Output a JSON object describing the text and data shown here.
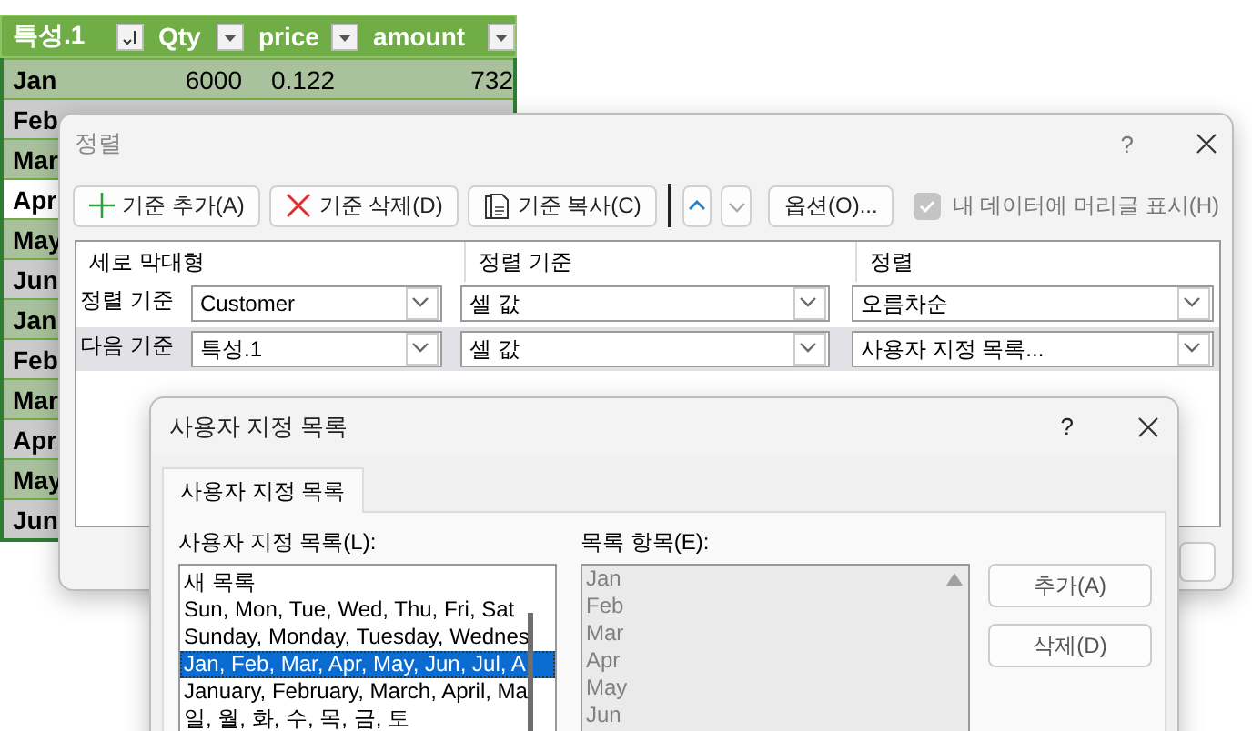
{
  "spreadsheet": {
    "columns": [
      {
        "label": "특성.1"
      },
      {
        "label": "Qty"
      },
      {
        "label": "price"
      },
      {
        "label": "amount"
      }
    ],
    "rows": [
      {
        "month": "Jan",
        "qty": "6000",
        "price": "0.122",
        "amount": "732",
        "selected": false
      },
      {
        "month": "Feb",
        "selected": false
      },
      {
        "month": "Mar",
        "selected": false
      },
      {
        "month": "Apr",
        "selected": true
      },
      {
        "month": "May",
        "selected": false
      },
      {
        "month": "Jun",
        "selected": false
      },
      {
        "month": "Jan",
        "selected": false
      },
      {
        "month": "Feb",
        "selected": false
      },
      {
        "month": "Mar",
        "selected": false
      },
      {
        "month": "Apr",
        "selected": false
      },
      {
        "month": "May",
        "selected": false
      },
      {
        "month": "Jun",
        "selected": false
      }
    ]
  },
  "sort_dialog": {
    "title": "정렬",
    "help": "?",
    "toolbar": [
      {
        "label": "기준 추가(A)"
      },
      {
        "label": "기준 삭제(D)"
      },
      {
        "label": "기준 복사(C)"
      }
    ],
    "move_buttons": [
      {
        "disabled": false
      },
      {
        "disabled": true
      }
    ],
    "options_button": "옵션(O)...",
    "header_checkbox": {
      "label": "내 데이터에 머리글 표시(H)",
      "checked": true,
      "disabled": true
    },
    "columns": [
      "세로 막대형",
      "정렬 기준",
      "정렬"
    ],
    "levels": [
      {
        "label": "정렬 기준",
        "column": "Customer",
        "sort_on": "셀 값",
        "order": "오름차순",
        "selected": false
      },
      {
        "label": "다음 기준",
        "column": "특성.1",
        "sort_on": "셀 값",
        "order": "사용자 지정 목록...",
        "selected": true
      }
    ]
  },
  "list_dialog": {
    "title": "사용자 지정 목록",
    "help": "?",
    "tab": {
      "label": "사용자 지정 목록",
      "selected": true
    },
    "lists_label": "사용자 지정 목록(L):",
    "lists": [
      {
        "text": "새 목록",
        "selected": false
      },
      {
        "text": "Sun, Mon, Tue, Wed, Thu, Fri, Sat",
        "selected": false
      },
      {
        "text": "Sunday, Monday, Tuesday, Wednes",
        "selected": false
      },
      {
        "text": "Jan, Feb, Mar, Apr, May, Jun, Jul, A",
        "selected": true
      },
      {
        "text": "January, February, March, April, Ma",
        "selected": false
      },
      {
        "text": "일, 월, 화, 수, 목, 금, 토",
        "selected": false
      }
    ],
    "entries_label": "목록 항목(E):",
    "entries": {
      "disabled": true,
      "items": [
        "Jan",
        "Feb",
        "Mar",
        "Apr",
        "May",
        "Jun"
      ]
    },
    "buttons": [
      "추가(A)",
      "삭제(D)"
    ]
  }
}
